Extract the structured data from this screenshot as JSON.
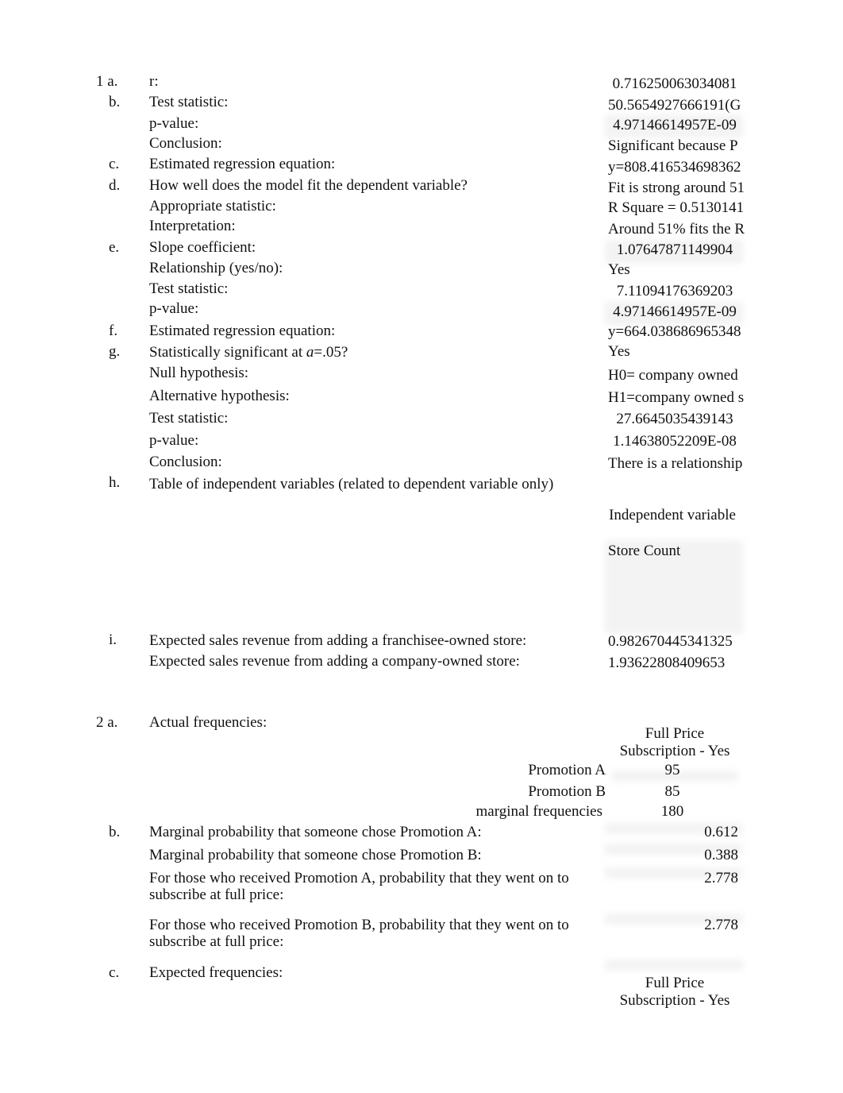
{
  "q1": {
    "number": "1",
    "items": [
      {
        "letter": "a.",
        "label": "r:",
        "value": "0.716250063034081"
      },
      {
        "letter": "b.",
        "label": "Test statistic:",
        "value": "50.5654927666191(G"
      },
      {
        "letter": "",
        "label": "p-value:",
        "value": "4.97146614957E-09"
      },
      {
        "letter": "",
        "label": "Conclusion:",
        "value": "Significant because P"
      },
      {
        "letter": "c.",
        "label": "Estimated regression equation:",
        "value": "y=808.416534698362"
      },
      {
        "letter": "d.",
        "label": "How well does the model fit the dependent variable?",
        "value": "Fit is strong around 51"
      },
      {
        "letter": "",
        "label": "Appropriate statistic:",
        "value": "R Square = 0.5130141"
      },
      {
        "letter": "",
        "label": "Interpretation:",
        "value": "Around 51% fits the R"
      },
      {
        "letter": "e.",
        "label": "Slope coefficient:",
        "value": "1.07647871149904"
      },
      {
        "letter": "",
        "label": "Relationship (yes/no):",
        "value": "Yes"
      },
      {
        "letter": "",
        "label": "Test statistic:",
        "value": "7.11094176369203"
      },
      {
        "letter": "",
        "label": "p-value:",
        "value": "4.97146614957E-09"
      },
      {
        "letter": "f.",
        "label": "Estimated regression equation:",
        "value": "y=664.038686965348"
      },
      {
        "letter": "g.",
        "label_prefix": "Statistically significant at ",
        "label_symbol": "a",
        "label_suffix": "=.05?",
        "value": "Yes"
      },
      {
        "letter": "",
        "label": "Null hypothesis:",
        "value": "H0= company owned"
      },
      {
        "letter": "",
        "label": "Alternative hypothesis:",
        "value": "H1=company owned s"
      },
      {
        "letter": "",
        "label": "Test statistic:",
        "value": "27.6645035439143"
      },
      {
        "letter": "",
        "label": "p-value:",
        "value": "1.14638052209E-08"
      },
      {
        "letter": "",
        "label": "Conclusion:",
        "value": "There is a relationship"
      },
      {
        "letter": "h.",
        "label": "Table of independent variables (related to dependent variable only)"
      }
    ],
    "h_table": {
      "header": "Independent variable",
      "rows": [
        "Store Count",
        "",
        "",
        "",
        ""
      ]
    },
    "i": {
      "letter": "i.",
      "franchisee_label": "Expected sales revenue from adding a franchisee-owned store:",
      "franchisee_value": "0.982670445341325",
      "company_label": "Expected sales revenue from adding a company-owned store:",
      "company_value": "1.93622808409653"
    }
  },
  "q2": {
    "number": "2",
    "a": {
      "letter": "a.",
      "label": "Actual frequencies:",
      "column_header": "Full Price Subscription - Yes",
      "rows": [
        {
          "label": "Promotion A",
          "value": "95"
        },
        {
          "label": "Promotion B",
          "value": "85"
        },
        {
          "label": "marginal frequencies",
          "value": "180"
        }
      ]
    },
    "b": {
      "letter": "b.",
      "items": [
        {
          "label": "Marginal probability that someone chose Promotion A:",
          "value": "0.612"
        },
        {
          "label": "Marginal probability that someone chose Promotion B:",
          "value": "0.388"
        },
        {
          "label": "For those who received Promotion A, probability that they went on to subscribe at full price:",
          "value": "2.778"
        },
        {
          "label": "For those who received Promotion B, probability that they went on to subscribe at full price:",
          "value": "2.778"
        }
      ]
    },
    "c": {
      "letter": "c.",
      "label": "Expected frequencies:",
      "column_header": "Full Price Subscription - Yes"
    }
  }
}
